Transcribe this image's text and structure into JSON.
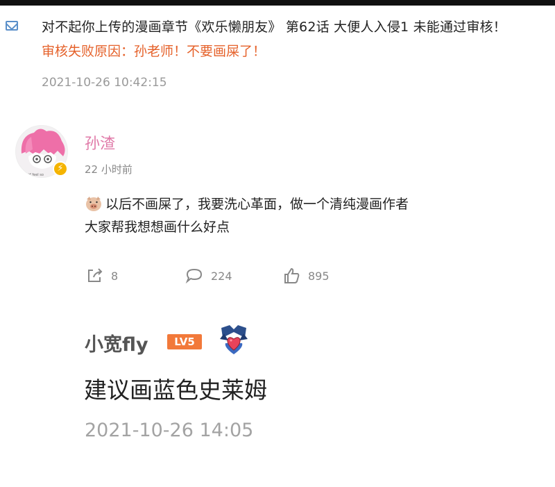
{
  "notification": {
    "icon": "mail-icon",
    "message": "对不起你上传的漫画章节《欢乐懒朋友》 第62话 大便人入侵1 未能通过审核！",
    "reason": "审核失败原因：孙老师！不要画屎了！",
    "timestamp": "2021-10-26 10:42:15"
  },
  "post": {
    "username": "孙渣",
    "time_ago": "22 小时前",
    "avatar_caption": "wtf feel so",
    "line1": "以后不画屎了，我要洗心革面，做一个清纯漫画作者",
    "line2": "大家帮我想想画什么好点",
    "actions": {
      "share_count": "8",
      "comment_count": "224",
      "like_count": "895"
    },
    "colors": {
      "username": "#e07aa8",
      "verified": "#f5b400"
    }
  },
  "reply": {
    "username": "小宽fly",
    "level_badge": "LV5",
    "text": "建议画蓝色史莱姆",
    "timestamp": "2021-10-26 14:05",
    "colors": {
      "level_badge": "#f2793a"
    }
  }
}
